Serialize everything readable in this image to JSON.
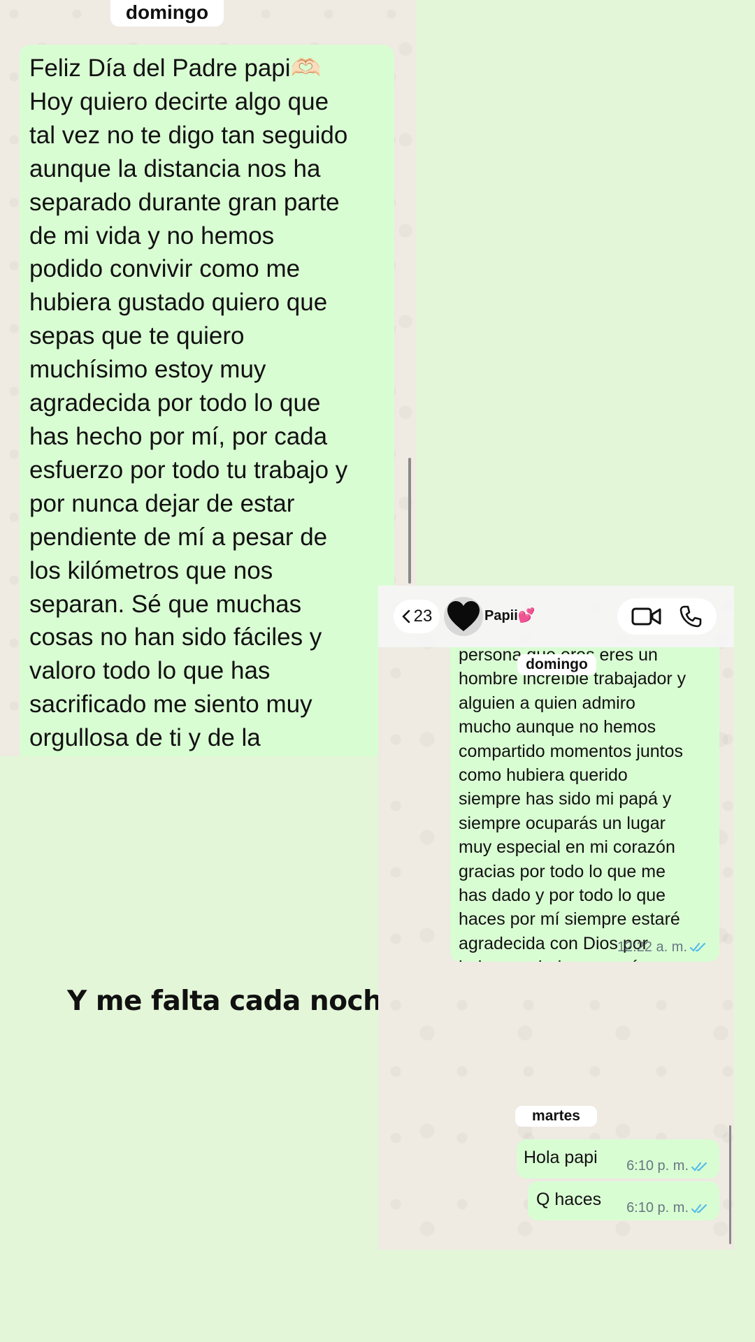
{
  "screenshot_top": {
    "day_label": "domingo",
    "message_text": "Feliz Día del Padre papi🫶🏻\nHoy quiero decirte algo que\ntal vez no te digo tan seguido\naunque la distancia nos ha\nseparado durante gran parte\nde mi vida y no hemos\npodido convivir como me\nhubiera gustado quiero que\nsepas que te quiero\nmuchísimo estoy muy\nagradecida por todo lo que\nhas hecho por mí, por cada\nesfuerzo por todo tu trabajo y\npor nunca dejar de estar\npendiente de mí a pesar de\nlos kilómetros que nos\nseparan. Sé que muchas\ncosas no han sido fáciles y\nvaloro todo lo que has\nsacrificado me siento muy\norgullosa de ti y de la"
  },
  "overlay": {
    "text": "Y me falta cada noche"
  },
  "screenshot_bottom": {
    "header": {
      "back_count": "23",
      "contact_name": "Papii💕",
      "icons": [
        "chevron-left-icon",
        "heart-avatar",
        "video-call-icon",
        "phone-call-icon"
      ]
    },
    "floating_day_label": "domingo",
    "long_message": {
      "text": "persona que eres eres un\nhombre increíble trabajador y\nalguien a quien admiro\nmucho aunque no hemos\ncompartido momentos juntos\ncomo hubiera querido\nsiempre has sido mi papá y\nsiempre ocuparás un lugar\nmuy especial en mi corazón\ngracias por todo lo que me\nhas dado y por todo lo que\nhaces por mí siempre estaré\nagradecida con Dios por\nhaberme dado un papá como\ntú te amo mucho papa\nEspero que tengas un\nhermoso Día del Padre❣️🫂",
      "time": "12:22 a. m."
    },
    "day_label": "martes",
    "messages": [
      {
        "text": "Hola papi",
        "time": "6:10 p. m."
      },
      {
        "text": "Q haces",
        "time": "6:10 p. m."
      }
    ],
    "colors": {
      "outgoing_bubble": "#d9fdd3",
      "read_ticks": "#53bdeb",
      "time_text": "#667781"
    }
  }
}
